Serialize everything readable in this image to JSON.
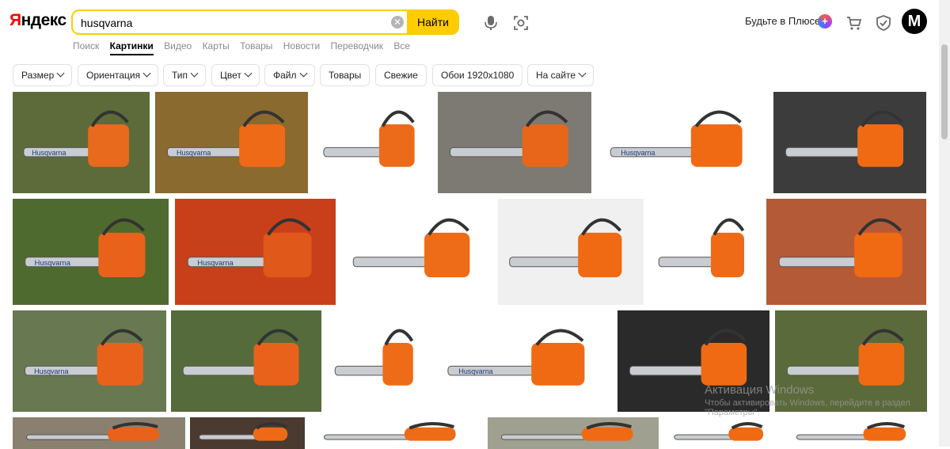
{
  "header": {
    "logo": "Яндекс",
    "search_value": "husqvarna",
    "search_button": "Найти",
    "plus_text": "Будьте в Плюсе",
    "avatar_letter": "M"
  },
  "services": [
    "Поиск",
    "Картинки",
    "Видео",
    "Карты",
    "Товары",
    "Новости",
    "Переводчик",
    "Все"
  ],
  "filters": [
    "Размер",
    "Ориентация",
    "Тип",
    "Цвет",
    "Файл",
    "Товары",
    "Свежие",
    "Обои 1920x1080",
    "На сайте"
  ],
  "results": {
    "rows": [
      [
        {
          "bg": "#5d6b3a",
          "accent": "#e86a1c",
          "label": "Husqvarna"
        },
        {
          "bg": "#8a6a2e",
          "accent": "#ef6a17",
          "label": "Husqvarna"
        },
        {
          "bg": "#ffffff",
          "accent": "#ec6b1a",
          "label": ""
        },
        {
          "bg": "#7c7a72",
          "accent": "#e8661a",
          "label": ""
        },
        {
          "bg": "#ffffff",
          "accent": "#f06a14",
          "label": "Husqvarna"
        },
        {
          "bg": "#3c3c3c",
          "accent": "#f06a14",
          "label": ""
        }
      ],
      [
        {
          "bg": "#4f6a2e",
          "accent": "#e9621b",
          "label": "Husqvarna"
        },
        {
          "bg": "#c8401a",
          "accent": "#e0581a",
          "label": "Husqvarna"
        },
        {
          "bg": "#ffffff",
          "accent": "#ee6b17",
          "label": ""
        },
        {
          "bg": "#f0f0f0",
          "accent": "#f06a14",
          "label": ""
        },
        {
          "bg": "#ffffff",
          "accent": "#ef6a17",
          "label": ""
        },
        {
          "bg": "#b55a36",
          "accent": "#f06a14",
          "label": ""
        }
      ],
      [
        {
          "bg": "#687850",
          "accent": "#e9621b",
          "label": "Husqvarna"
        },
        {
          "bg": "#566b3c",
          "accent": "#e9621b",
          "label": ""
        },
        {
          "bg": "#ffffff",
          "accent": "#ee6b17",
          "label": ""
        },
        {
          "bg": "#ffffff",
          "accent": "#f06a14",
          "label": "Husqvarna"
        },
        {
          "bg": "#2a2a2a",
          "accent": "#f06a14",
          "label": ""
        },
        {
          "bg": "#5a6a3a",
          "accent": "#f06a14",
          "label": ""
        }
      ],
      [
        {
          "bg": "#8a8070",
          "accent": "#e9621b",
          "label": ""
        },
        {
          "bg": "#4a3a30",
          "accent": "#ef6a17",
          "label": ""
        },
        {
          "bg": "#ffffff",
          "accent": "#ee6b17",
          "label": ""
        },
        {
          "bg": "#a0a090",
          "accent": "#f06a14",
          "label": ""
        },
        {
          "bg": "#ffffff",
          "accent": "#f06a14",
          "label": ""
        },
        {
          "bg": "#ffffff",
          "accent": "#f06a14",
          "label": ""
        }
      ]
    ]
  },
  "watermark": {
    "line1": "Активация Windows",
    "line2": "Чтобы активировать Windows, перейдите в раздел",
    "line3": "\"Параметры\"."
  },
  "colors": {
    "search_border": "#ffcc00",
    "search_button": "#ffcc00",
    "logo_red": "#ff0000"
  }
}
